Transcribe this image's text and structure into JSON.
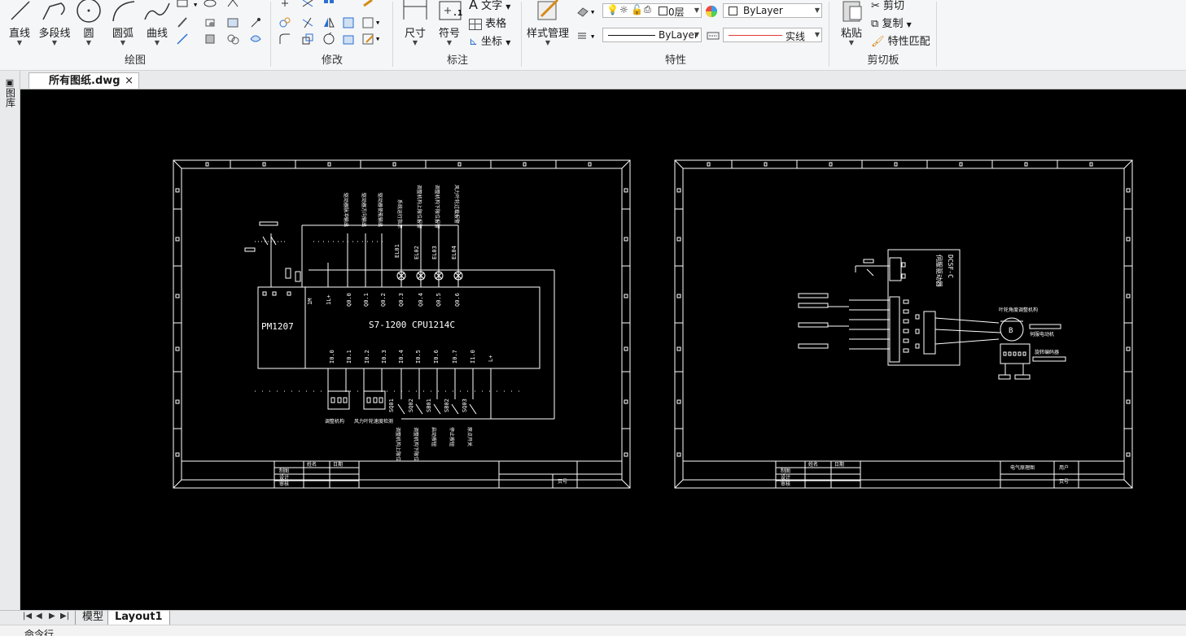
{
  "ribbon": {
    "draw": {
      "title": "绘图",
      "line": "直线",
      "polyline": "多段线",
      "circle": "圆",
      "arc": "圆弧",
      "curve": "曲线"
    },
    "modify": {
      "title": "修改"
    },
    "annotate": {
      "title": "标注",
      "dimension": "尺寸",
      "symbol": "符号",
      "text": "文字",
      "table": "表格",
      "coordinate": "坐标"
    },
    "properties": {
      "title": "特性",
      "style_manager": "样式管理",
      "layer": "0层",
      "color": "ByLayer",
      "linetype": "ByLayer",
      "lineweight": "实线"
    },
    "clipboard": {
      "title": "剪切板",
      "paste": "粘贴",
      "cut": "剪切",
      "copy": "复制",
      "match": "特性匹配"
    }
  },
  "tabs": {
    "doc": "所有图纸.dwg",
    "close": "×"
  },
  "left_strip": "图库",
  "layouts": {
    "model": "模型",
    "layout1": "Layout1"
  },
  "command_line": "命令行",
  "drawing": {
    "sheet1": {
      "plc_title": "S7-1200 CPU1214C",
      "psu": "PM1207",
      "top_terminals": [
        "1M",
        "1L+",
        "Q0.0",
        "Q0.1",
        "Q0.2",
        "Q0.3",
        "Q0.4",
        "Q0.5",
        "Q0.6"
      ],
      "bottom_terminals": [
        "I0.0",
        "I0.1",
        "I0.2",
        "I0.3",
        "I0.4",
        "I0.5",
        "I0.6",
        "I0.7",
        "I1.0",
        "L+"
      ],
      "lamps": [
        "EL01",
        "EL02",
        "EL03",
        "EL04"
      ],
      "out_labels": [
        "驱动器脉冲输出",
        "驱动器方向输出",
        "驱动器使能输出",
        "系统运行指示",
        "调整机构上限位报警",
        "调整机构下限位报警",
        "风力叶轮过载报警"
      ],
      "switches": [
        "SQ01",
        "SQ02",
        "SB01",
        "SB02",
        "SQ03"
      ],
      "in_labels": [
        "调整机构上限位",
        "调整机构下限位",
        "启动按钮",
        "停止按钮",
        "原点开关"
      ],
      "sensors": [
        "调整机构",
        "风力叶轮速度检测"
      ],
      "tb": {
        "name": "姓名",
        "date": "日期",
        "draw": "制图",
        "design": "设计",
        "check": "审核",
        "page": "页号"
      }
    },
    "sheet2": {
      "driver": "伺服驱动器",
      "driver_model": "DCSF-C",
      "motor_mech": "叶轮角度调整机构",
      "motor": "伺服电动机",
      "motor_symbol": "B",
      "encoder": "旋转编码器",
      "tb": {
        "name": "姓名",
        "date": "日期",
        "draw": "制图",
        "design": "设计",
        "check": "审核",
        "title": "电气原理图",
        "user": "用户",
        "page": "页号"
      }
    }
  }
}
